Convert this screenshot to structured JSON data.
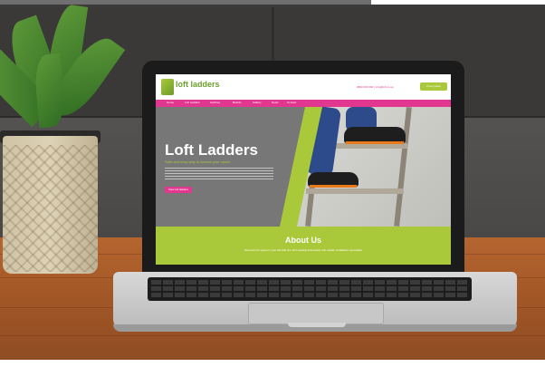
{
  "website": {
    "logo_text": "loft ladders",
    "phone": "0800 000 000 | info@loft.co.uk",
    "quote_label": "Free Quote",
    "nav": [
      "Home",
      "Loft Ladders",
      "Hatches",
      "Boards",
      "Gallery",
      "News",
      "Contact"
    ],
    "hero": {
      "title": "Loft Ladders",
      "subtitle": "Safe and easy way to access your space",
      "cta_label": "View loft ladders"
    },
    "about": {
      "title": "About Us",
      "text": "Discover the space in your loft with the UK's leading Automated Loft Ladder Installation specialists"
    }
  },
  "colors": {
    "brand_pink": "#e2378f",
    "brand_green": "#a9c93a",
    "hero_grey": "#777777",
    "table_wood": "#a35727",
    "sofa": "#3a3937"
  },
  "icons": [
    "logo-mark-icon",
    "plant-icon",
    "laptop-icon"
  ]
}
